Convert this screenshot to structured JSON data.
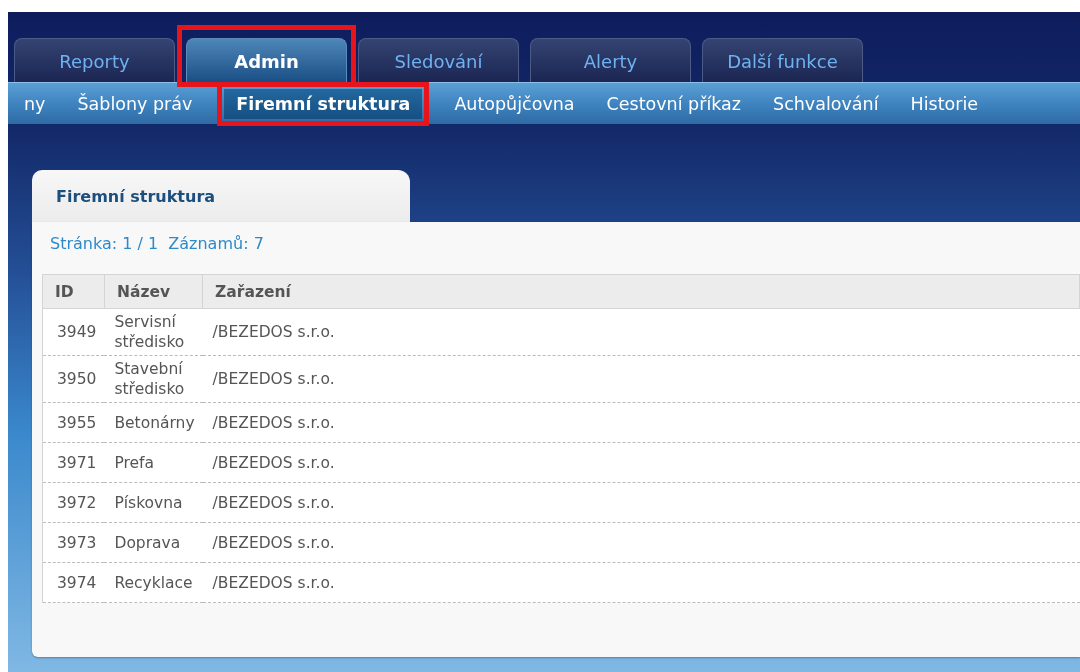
{
  "tabs": [
    {
      "label": "Reporty",
      "selected": false,
      "highlighted": false
    },
    {
      "label": "Admin",
      "selected": true,
      "highlighted": true
    },
    {
      "label": "Sledování",
      "selected": false,
      "highlighted": false
    },
    {
      "label": "Alerty",
      "selected": false,
      "highlighted": false
    },
    {
      "label": "Další funkce",
      "selected": false,
      "highlighted": false
    }
  ],
  "submenu": [
    {
      "label": "ny",
      "selected": false,
      "highlighted": false
    },
    {
      "label": "Šablony práv",
      "selected": false,
      "highlighted": false
    },
    {
      "label": "Firemní struktura",
      "selected": true,
      "highlighted": true
    },
    {
      "label": "Autopůjčovna",
      "selected": false,
      "highlighted": false
    },
    {
      "label": "Cestovní příkaz",
      "selected": false,
      "highlighted": false
    },
    {
      "label": "Schvalování",
      "selected": false,
      "highlighted": false
    },
    {
      "label": "Historie",
      "selected": false,
      "highlighted": false
    }
  ],
  "panel": {
    "title": "Firemní struktura",
    "pager": "Stránka: 1 / 1  Záznamů: 7",
    "table": {
      "columns": [
        "ID",
        "Název",
        "Zařazení"
      ],
      "rows": [
        [
          "3949",
          "Servisní středisko",
          "/BEZEDOS s.r.o."
        ],
        [
          "3950",
          "Stavební středisko",
          "/BEZEDOS s.r.o."
        ],
        [
          "3955",
          "Betonárny",
          "/BEZEDOS s.r.o."
        ],
        [
          "3971",
          "Prefa",
          "/BEZEDOS s.r.o."
        ],
        [
          "3972",
          "Pískovna",
          "/BEZEDOS s.r.o."
        ],
        [
          "3973",
          "Doprava",
          "/BEZEDOS s.r.o."
        ],
        [
          "3974",
          "Recyklace",
          "/BEZEDOS s.r.o."
        ]
      ]
    }
  }
}
